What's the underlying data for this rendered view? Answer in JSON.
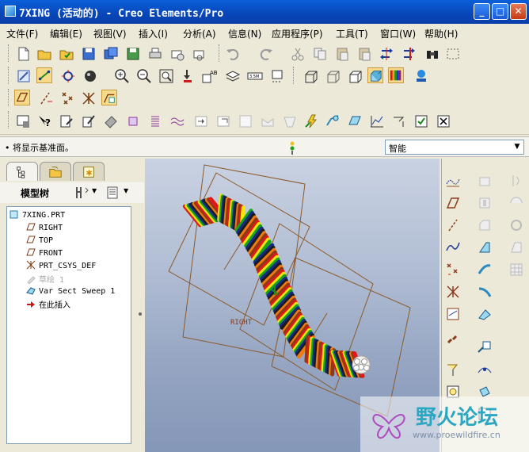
{
  "window": {
    "title": "7XING (活动的) - Creo Elements/Pro",
    "minimize_icon": "minimize-icon",
    "maximize_icon": "maximize-icon",
    "close_icon": "close-icon"
  },
  "menubar": {
    "items": [
      {
        "label": "文件(F)"
      },
      {
        "label": "编辑(E)"
      },
      {
        "label": "视图(V)"
      },
      {
        "label": "插入(I)"
      },
      {
        "label": "分析(A)"
      },
      {
        "label": "信息(N)"
      },
      {
        "label": "应用程序(P)"
      },
      {
        "label": "工具(T)"
      },
      {
        "label": "窗口(W)"
      },
      {
        "label": "帮助(H)"
      }
    ]
  },
  "message": {
    "text": "• 将显示基准面。"
  },
  "filter": {
    "value": "智能"
  },
  "navigator": {
    "tree_title": "模型树",
    "items": [
      {
        "label": "7XING.PRT",
        "icon": "part-icon"
      },
      {
        "label": "RIGHT",
        "icon": "datum-plane-icon"
      },
      {
        "label": "TOP",
        "icon": "datum-plane-icon"
      },
      {
        "label": "FRONT",
        "icon": "datum-plane-icon"
      },
      {
        "label": "PRT_CSYS_DEF",
        "icon": "csys-icon"
      },
      {
        "label": "草绘 1",
        "icon": "sketch-icon"
      },
      {
        "label": "Var Sect Sweep 1",
        "icon": "var-sect-sweep-icon"
      },
      {
        "label": "在此插入",
        "icon": "insert-here-arrow-icon"
      }
    ]
  },
  "graphics": {
    "datum_label": "RIGHT"
  },
  "watermark": {
    "text": "野火论坛",
    "url": "www.proewildfire.cn"
  },
  "colors": {
    "title_bar": "#0846b8",
    "strand_colors": [
      "#e01818",
      "#f2e60c",
      "#1aa31a",
      "#1a2a8a",
      "#1a1a1a",
      "#f07a10",
      "#8a3a1a"
    ]
  }
}
